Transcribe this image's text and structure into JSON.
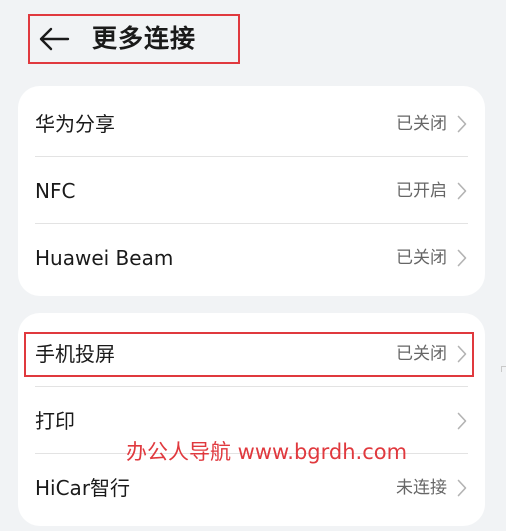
{
  "header": {
    "title": "更多连接",
    "back_icon": "back-arrow-icon"
  },
  "group1": [
    {
      "label": "华为分享",
      "value": "已关闭"
    },
    {
      "label": "NFC",
      "value": "已开启"
    },
    {
      "label": "Huawei Beam",
      "value": "已关闭"
    }
  ],
  "group2": [
    {
      "label": "手机投屏",
      "value": "已关闭"
    },
    {
      "label": "打印",
      "value": ""
    },
    {
      "label": "HiCar智行",
      "value": "未连接"
    }
  ],
  "watermark": "办公人导航 www.bgrdh.com",
  "colors": {
    "annotation_red": "#e0393e",
    "background": "#f1f3f5",
    "card": "#ffffff",
    "secondary_text": "#666666"
  }
}
